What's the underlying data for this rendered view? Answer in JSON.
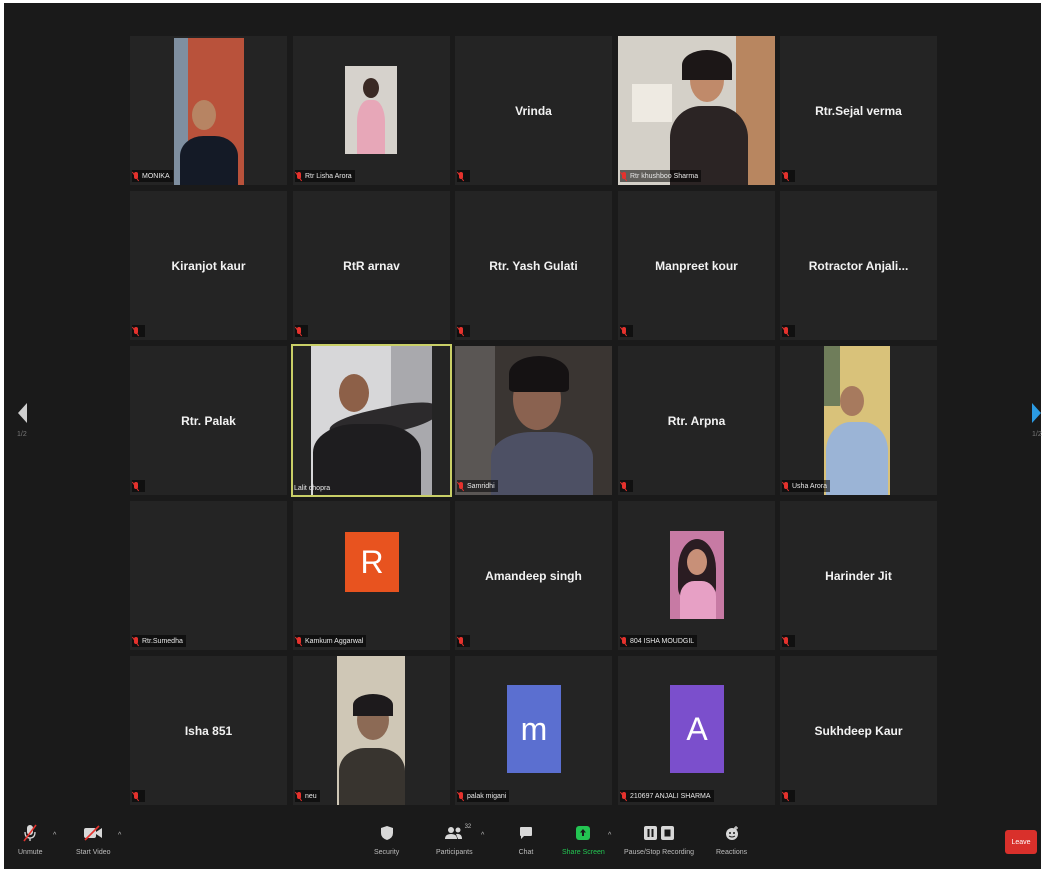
{
  "tiles": [
    {
      "name": "MONIKA",
      "video": true
    },
    {
      "name": "Rtr Lisha Arora",
      "video": true
    },
    {
      "name": "Vrinda",
      "video": false
    },
    {
      "name": "Rtr khushboo Sharma",
      "video": true
    },
    {
      "name": "Rtr.Sejal verma",
      "video": false
    },
    {
      "name": "Kiranjot kaur",
      "video": false
    },
    {
      "name": "RtR arnav",
      "video": false
    },
    {
      "name": "Rtr. Yash Gulati",
      "video": false
    },
    {
      "name": "Manpreet kour",
      "video": false
    },
    {
      "name": "Rotractor Anjali...",
      "video": false
    },
    {
      "name": "Rtr. Palak",
      "video": false
    },
    {
      "name": "Lalit chopra",
      "video": true,
      "active": true
    },
    {
      "name": "Samridhi",
      "video": true
    },
    {
      "name": "Rtr. Arpna",
      "video": false
    },
    {
      "name": "Usha Arora",
      "video": true
    },
    {
      "name": "Rtr.Sumedha",
      "video": false
    },
    {
      "name": "Kamkum Aggarwal",
      "avatar_letter": "R",
      "avatar_color": "#e8531f"
    },
    {
      "name": "Amandeep singh",
      "video": false
    },
    {
      "name": "804 ISHA MOUDGIL",
      "video": true
    },
    {
      "name": "Harinder Jit",
      "video": false
    },
    {
      "name": "Isha 851",
      "video": false
    },
    {
      "name": "neu",
      "video": true
    },
    {
      "name": "palak migani",
      "avatar_letter": "m",
      "avatar_color": "#5b6fd0"
    },
    {
      "name": "210697 ANJALI SHARMA",
      "avatar_letter": "A",
      "avatar_color": "#7b4fcc"
    },
    {
      "name": "Sukhdeep Kaur",
      "video": false
    }
  ],
  "nav": {
    "left_page": "1/2",
    "right_page": "1/2"
  },
  "toolbar": {
    "unmute": "Unmute",
    "start_video": "Start Video",
    "security": "Security",
    "participants": "Participants",
    "participants_count": "32",
    "chat": "Chat",
    "share_screen": "Share Screen",
    "recording": "Pause/Stop Recording",
    "reactions": "Reactions",
    "leave": "Leave"
  },
  "colors": {
    "accent_green": "#23c552",
    "mute_red": "#e5322d",
    "active_border": "#c9cf67",
    "leave_red": "#d9302b"
  }
}
